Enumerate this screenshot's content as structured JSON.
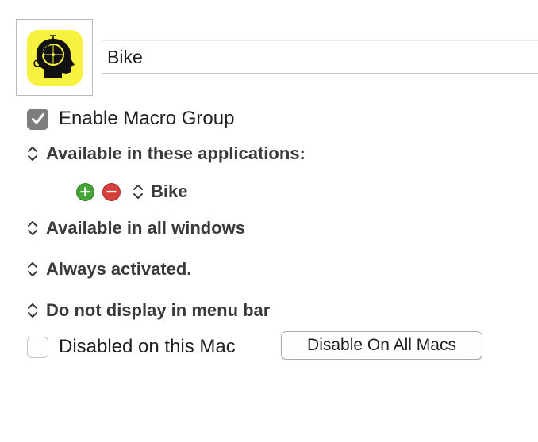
{
  "group": {
    "name": "Bike",
    "icon": "penny-farthing-head-icon",
    "icon_background": "#f7f23f"
  },
  "enable": {
    "label": "Enable Macro Group",
    "checked": true
  },
  "applications": {
    "popup_label": "Available in these applications:",
    "items": [
      {
        "name": "Bike"
      }
    ],
    "add_icon": "plus-circle-icon",
    "remove_icon": "minus-circle-icon"
  },
  "windows": {
    "popup_label": "Available in all windows"
  },
  "activation": {
    "popup_label": "Always activated."
  },
  "menu_bar": {
    "popup_label": "Do not display in menu bar"
  },
  "disabled_mac": {
    "label": "Disabled on this Mac",
    "checked": false
  },
  "disable_all_button": {
    "label": "Disable On All Macs"
  },
  "colors": {
    "add": "#45a537",
    "remove": "#d6413e",
    "checkbox_checked": "#7d7d7d"
  }
}
